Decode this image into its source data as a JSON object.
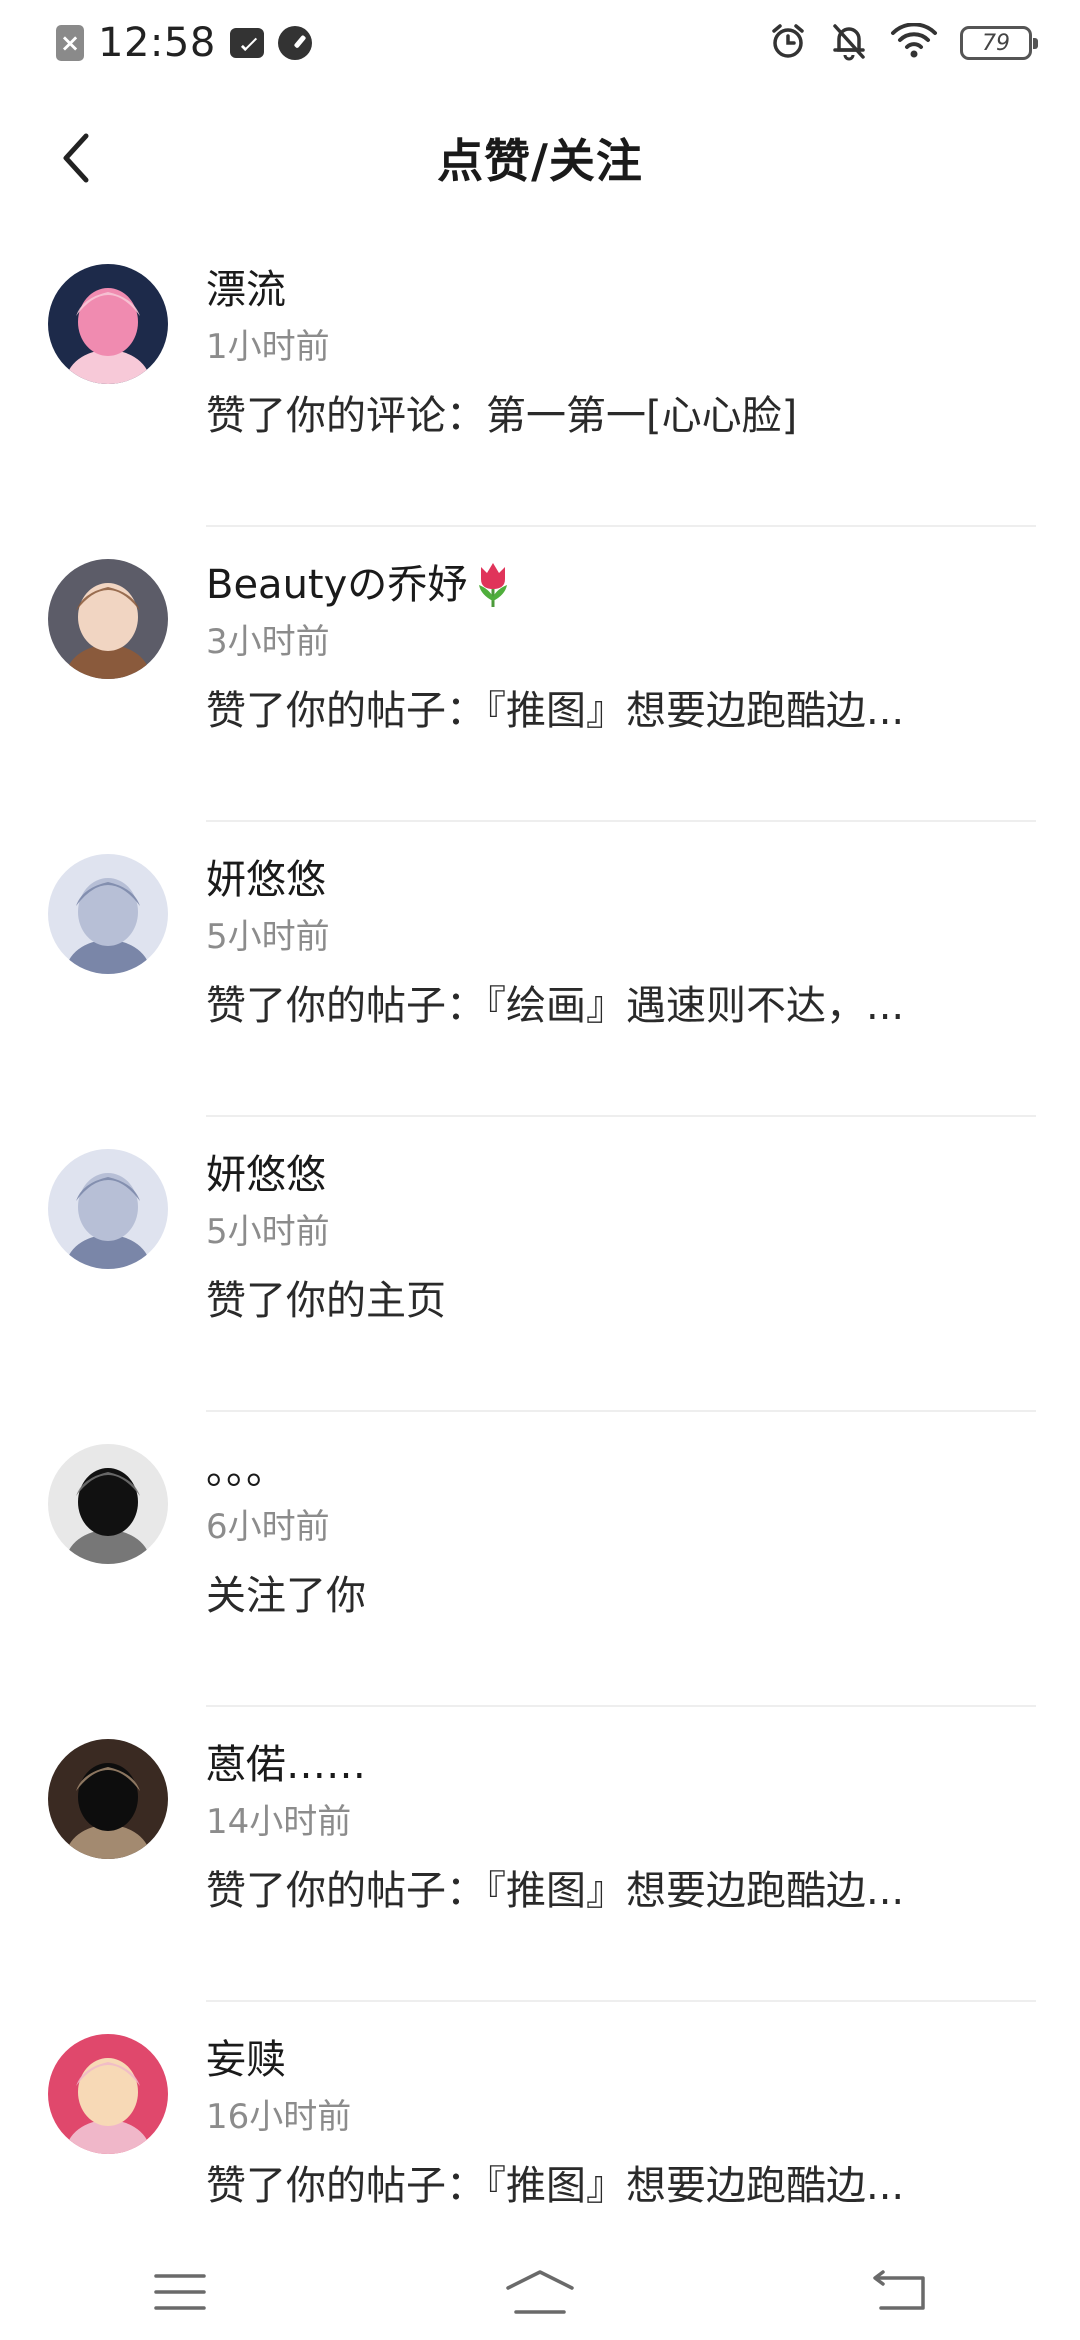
{
  "status_bar": {
    "time": "12:58",
    "battery": "79"
  },
  "header": {
    "title": "点赞/关注"
  },
  "notifications": [
    {
      "name": "漂流",
      "time": "1小时前",
      "text": "赞了你的评论：第一第一[心心脸]",
      "avatar_colors": [
        "#1d2a4a",
        "#f08bb0",
        "#f7c9d8"
      ]
    },
    {
      "name": "Beautyの乔妤",
      "time": "3小时前",
      "text": "赞了你的帖子：『推图』想要边跑酷边...",
      "avatar_colors": [
        "#5c5c68",
        "#f1d5c2",
        "#8a5a3c"
      ]
    },
    {
      "name": "妍悠悠",
      "time": "5小时前",
      "text": "赞了你的帖子：『绘画』遇速则不达，...",
      "avatar_colors": [
        "#dfe3ef",
        "#b7bfd6",
        "#7a86a8"
      ]
    },
    {
      "name": "妍悠悠",
      "time": "5小时前",
      "text": "赞了你的主页",
      "avatar_colors": [
        "#dfe3ef",
        "#b7bfd6",
        "#7a86a8"
      ]
    },
    {
      "name": "。。。",
      "time": "6小时前",
      "text": "关注了你",
      "avatar_colors": [
        "#e8e8e8",
        "#111111",
        "#777777"
      ]
    },
    {
      "name": "蒽偌……",
      "time": "14小时前",
      "text": "赞了你的帖子：『推图』想要边跑酷边...",
      "avatar_colors": [
        "#3a2a22",
        "#0d0d0d",
        "#a38a70"
      ]
    },
    {
      "name": "妄赎",
      "time": "16小时前",
      "text": "赞了你的帖子：『推图』想要边跑酷边...",
      "avatar_colors": [
        "#e0486c",
        "#f7d9b6",
        "#f0b7c9"
      ]
    }
  ],
  "icons": {
    "back": "chevron-left-icon",
    "tulip": "tulip-emoji-icon",
    "menu": "menu-icon",
    "home": "home-icon",
    "back_nav": "return-icon"
  }
}
